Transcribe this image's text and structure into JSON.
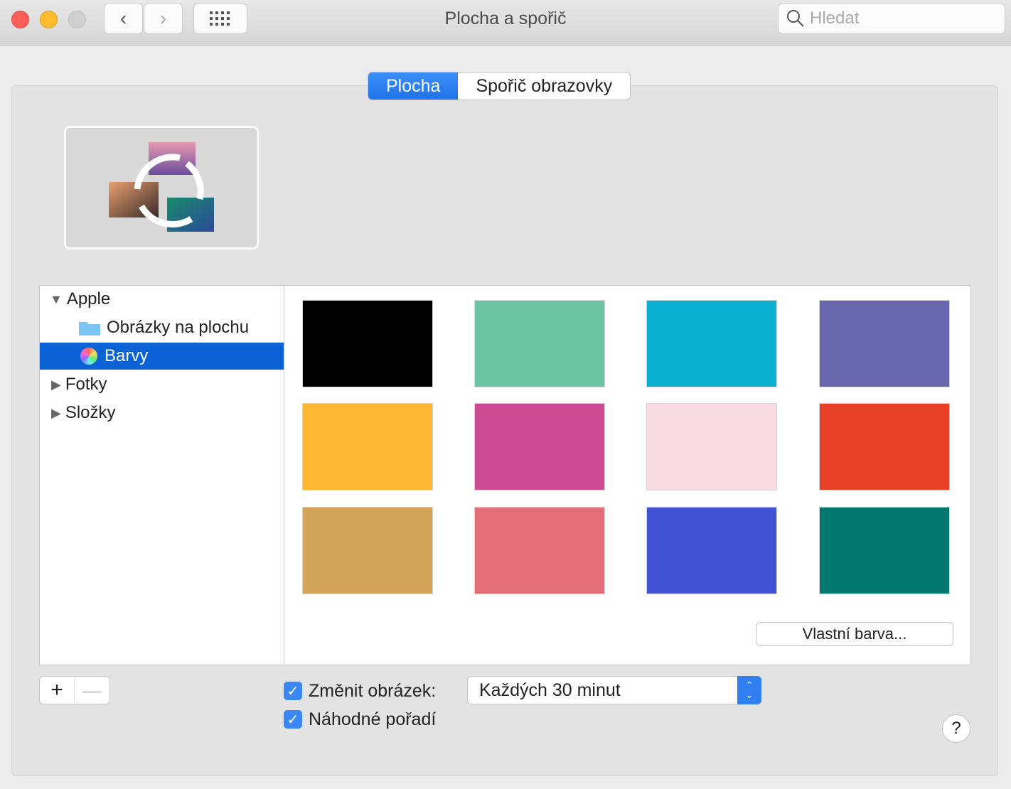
{
  "window": {
    "title": "Plocha a spořič",
    "search_placeholder": "Hledat"
  },
  "tabs": [
    {
      "label": "Plocha",
      "active": true
    },
    {
      "label": "Spořič obrazovky",
      "active": false
    }
  ],
  "sidebar": {
    "items": [
      {
        "label": "Apple",
        "expanded": true
      },
      {
        "label": "Obrázky na plochu"
      },
      {
        "label": "Barvy",
        "selected": true
      },
      {
        "label": "Fotky",
        "expanded": false
      },
      {
        "label": "Složky",
        "expanded": false
      }
    ]
  },
  "colors": [
    "#000000",
    "#6cc4a2",
    "#0bafd0",
    "#6967ad",
    "#fdb833",
    "#cc4b93",
    "#f9dce4",
    "#e9402a",
    "#d3a55b",
    "#e16e79",
    "#4153d2",
    "#01786f"
  ],
  "custom_color_label": "Vlastní barva...",
  "change_picture": {
    "label": "Změnit obrázek:",
    "checked": true,
    "interval": "Každých 30 minut"
  },
  "random_order": {
    "label": "Náhodné pořadí",
    "checked": true
  },
  "help_label": "?"
}
